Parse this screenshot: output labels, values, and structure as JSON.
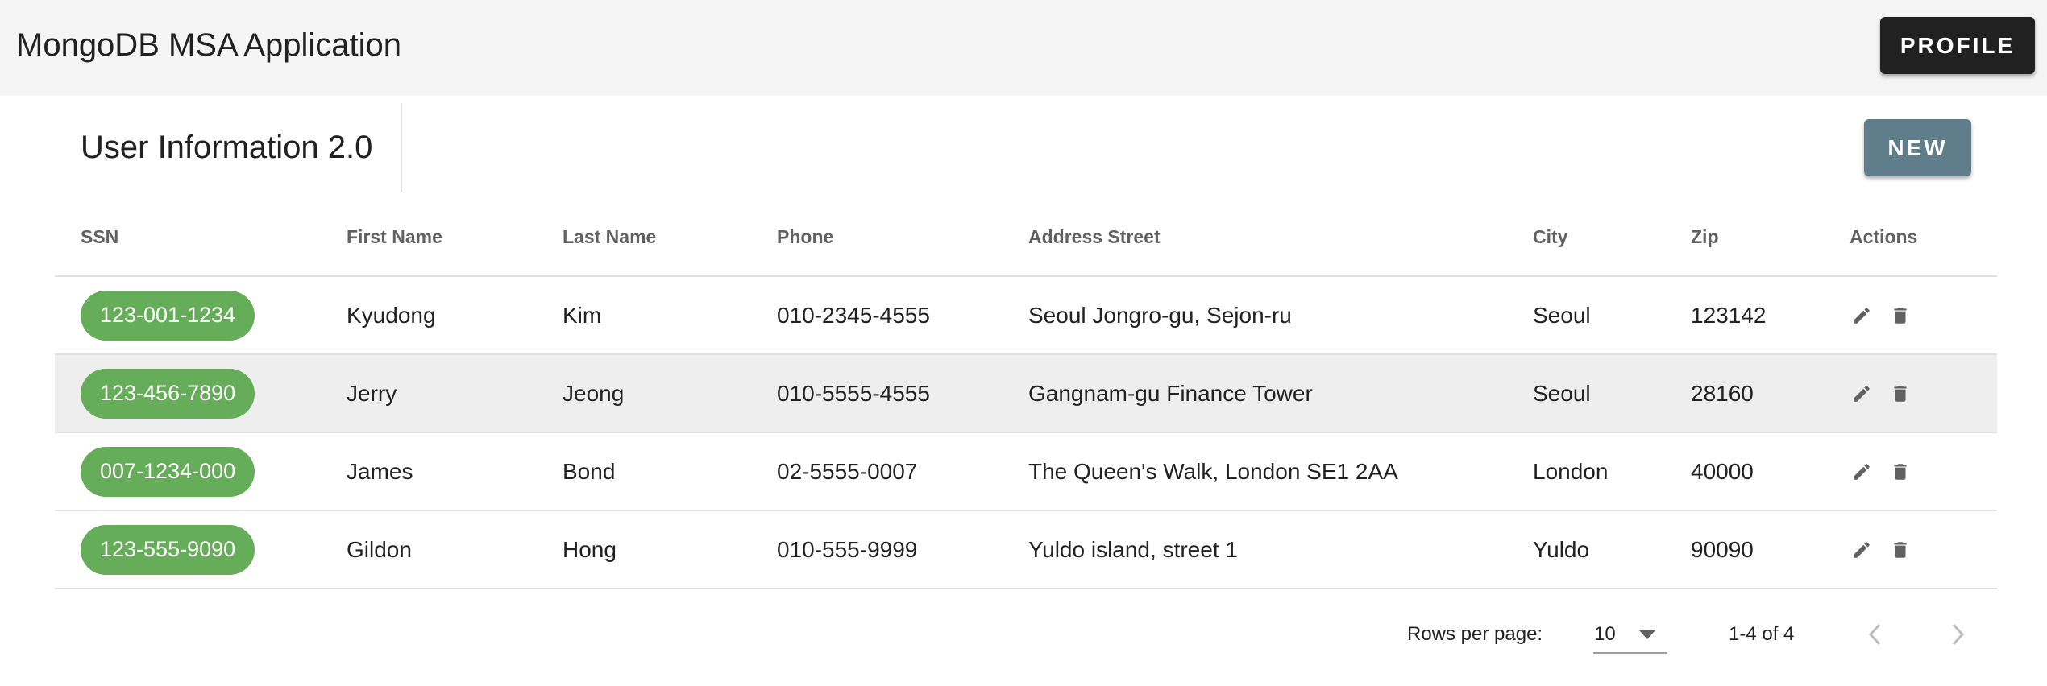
{
  "app": {
    "title": "MongoDB MSA Application",
    "profile_label": "PROFILE"
  },
  "toolbar": {
    "title": "User Information 2.0",
    "new_label": "NEW"
  },
  "table": {
    "columns": {
      "ssn": "SSN",
      "first_name": "First Name",
      "last_name": "Last Name",
      "phone": "Phone",
      "address": "Address Street",
      "city": "City",
      "zip": "Zip",
      "actions": "Actions"
    },
    "rows": [
      {
        "ssn": "123-001-1234",
        "first_name": "Kyudong",
        "last_name": "Kim",
        "phone": "010-2345-4555",
        "address": "Seoul Jongro-gu, Sejon-ru",
        "city": "Seoul",
        "zip": "123142"
      },
      {
        "ssn": "123-456-7890",
        "first_name": "Jerry",
        "last_name": "Jeong",
        "phone": "010-5555-4555",
        "address": "Gangnam-gu Finance Tower",
        "city": "Seoul",
        "zip": "28160"
      },
      {
        "ssn": "007-1234-000",
        "first_name": "James",
        "last_name": "Bond",
        "phone": "02-5555-0007",
        "address": "The Queen's Walk, London SE1 2AA",
        "city": "London",
        "zip": "40000"
      },
      {
        "ssn": "123-555-9090",
        "first_name": "Gildon",
        "last_name": "Hong",
        "phone": "010-555-9999",
        "address": "Yuldo island, street 1",
        "city": "Yuldo",
        "zip": "90090"
      }
    ],
    "action_icons": [
      "edit-icon",
      "delete-icon"
    ]
  },
  "pagination": {
    "rows_per_page_label": "Rows per page:",
    "rows_per_page_value": "10",
    "range_label": "1-4 of 4"
  },
  "colors": {
    "appbar_bg": "#f5f5f5",
    "profile_btn": "#212121",
    "new_btn": "#607d8b",
    "ssn_chip": "#66ad5a",
    "hover_row": "#eeeeee"
  }
}
